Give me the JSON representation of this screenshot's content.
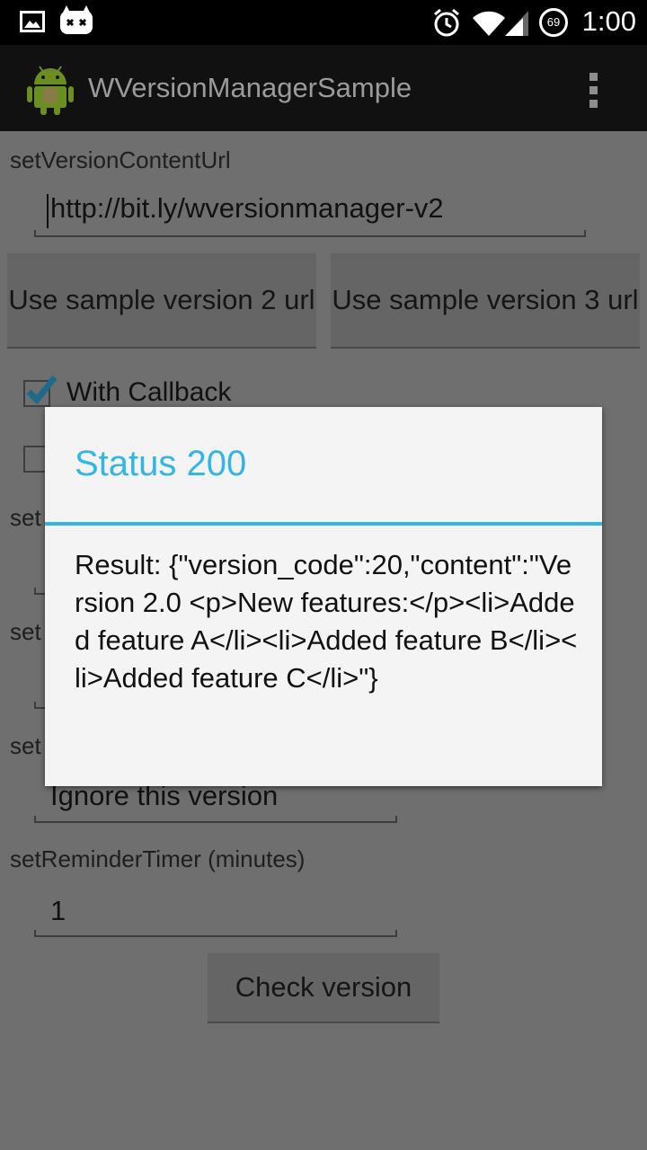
{
  "status_bar": {
    "time": "1:00",
    "battery_level": "69",
    "icons": [
      "image-icon",
      "cyanogen-icon",
      "alarm-icon",
      "wifi-icon",
      "signal-icon"
    ]
  },
  "action_bar": {
    "title": "WVersionManagerSample",
    "icons": [
      "android-app-icon",
      "overflow-menu-icon"
    ]
  },
  "form": {
    "content_url_label": "setVersionContentUrl",
    "content_url_value": "http://bit.ly/wversionmanager-v2",
    "sample_v2_button": "Use sample version 2 url",
    "sample_v3_button": "Use sample version 3 url",
    "with_callback_label": "With Callback",
    "with_callback_checked": true,
    "partial_label_1": "set",
    "partial_label_2": "set",
    "partial_label_3": "set",
    "ignore_button_text": "Ignore this version",
    "reminder_label": "setReminderTimer (minutes)",
    "reminder_value": "1",
    "check_version_button": "Check version"
  },
  "dialog": {
    "title": "Status 200",
    "message": "Result: {\"version_code\":20,\"content\":\"Version 2.0 <p>New features:</p><li>Added feature A</li><li>Added feature B</li><li>Added feature C</li>\"}"
  },
  "colors": {
    "accent": "#33b5e5",
    "dim_background": "#6f6f6f",
    "dialog_background": "#f4f4f4"
  }
}
